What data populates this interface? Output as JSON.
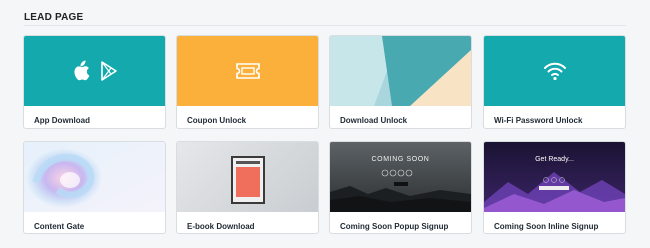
{
  "section": {
    "title": "LEAD PAGE"
  },
  "colors": {
    "teal": "#14a9ad",
    "orange": "#fbb03b",
    "page_bg": "#f4f6f8"
  },
  "cards": [
    {
      "label": "App Download",
      "thumbnail": "teal-with-apple-and-play-icons"
    },
    {
      "label": "Coupon Unlock",
      "thumbnail": "orange-with-ticket-icon"
    },
    {
      "label": "Download Unlock",
      "thumbnail": "geometric-teal-cream-shapes"
    },
    {
      "label": "Wi-Fi Password Unlock",
      "thumbnail": "teal-with-wifi-icon"
    },
    {
      "label": "Content Gate",
      "thumbnail": "soft-gradient-swirl"
    },
    {
      "label": "E-book Download",
      "thumbnail": "gray-with-book-cover"
    },
    {
      "label": "Coming Soon Popup Signup",
      "thumbnail": "dark-landscape-coming-soon",
      "headline": "COMING SOON"
    },
    {
      "label": "Coming Soon Inline Signup",
      "thumbnail": "purple-mountain-get-ready",
      "headline": "Get Ready..."
    }
  ]
}
